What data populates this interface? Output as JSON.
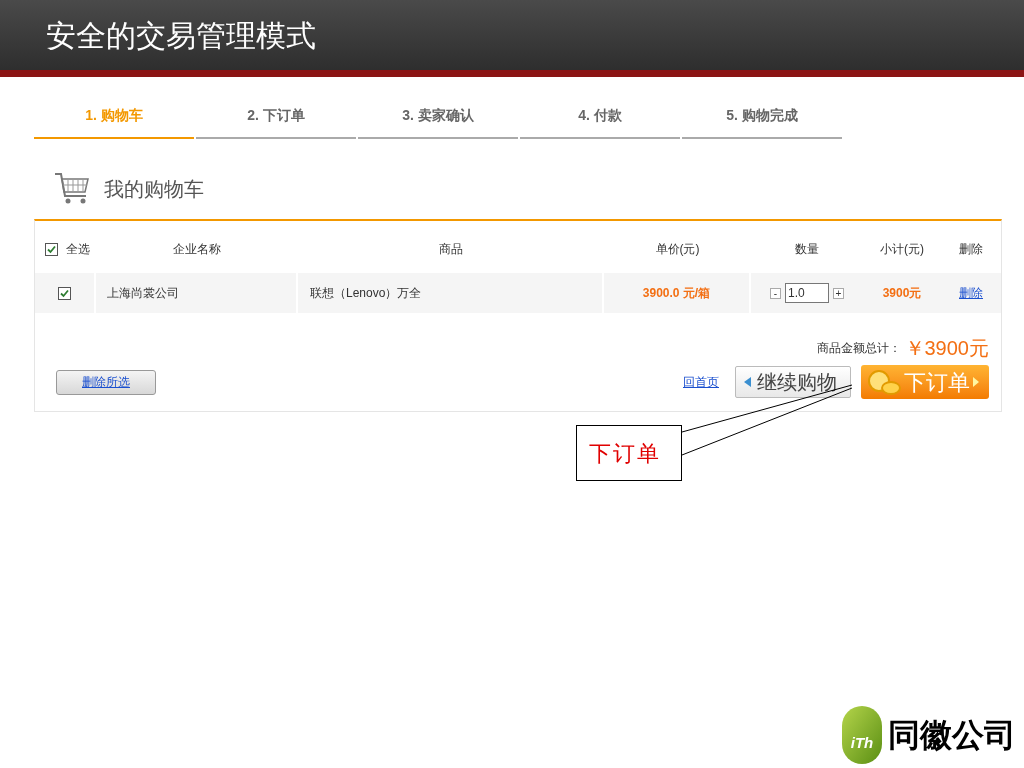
{
  "title": "安全的交易管理模式",
  "steps": [
    {
      "label": "1. 购物车",
      "selected": true
    },
    {
      "label": "2. 下订单",
      "selected": false
    },
    {
      "label": "3. 卖家确认",
      "selected": false
    },
    {
      "label": "4. 付款",
      "selected": false
    },
    {
      "label": "5. 购物完成",
      "selected": false
    }
  ],
  "cart_heading": "我的购物车",
  "table": {
    "select_all": {
      "label": "全选",
      "checked": true
    },
    "columns": [
      "企业名称",
      "商品",
      "单价(元)",
      "数量",
      "小计(元)",
      "删除"
    ],
    "rows": [
      {
        "checked": true,
        "company": "上海尚裳公司",
        "product": "联想（Lenovo）万全",
        "unit_price": "3900.0 元/箱",
        "minus": "-",
        "quantity": "1.0",
        "plus": "+",
        "subtotal": "3900元",
        "delete": "删除"
      }
    ]
  },
  "summary": {
    "label": "商品金额总计：",
    "amount": "￥3900元"
  },
  "delete_selected": "删除所选",
  "home_link": "回首页",
  "continue_button": "继续购物",
  "order_button": "下订单",
  "callout": "下订单",
  "logo": {
    "mark": "iTh",
    "name": "同徽公司"
  }
}
